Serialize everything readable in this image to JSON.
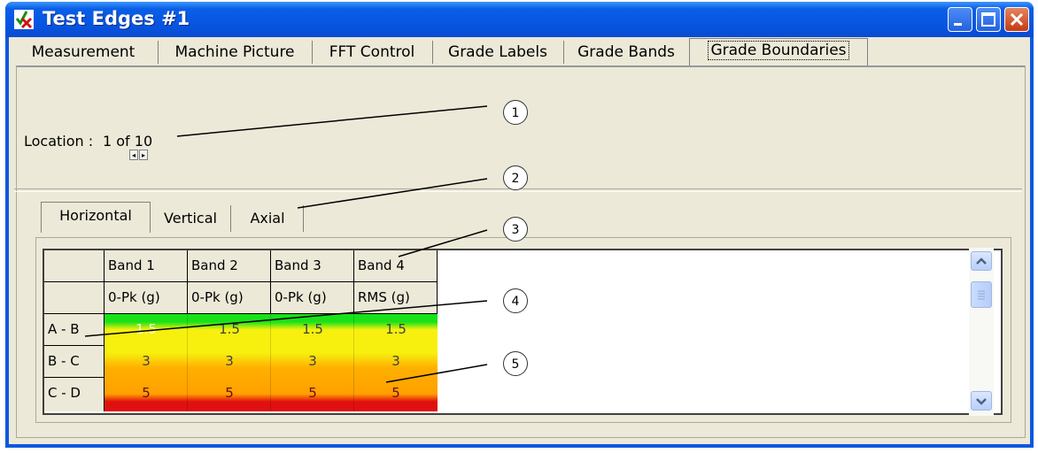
{
  "window": {
    "title": "Test Edges #1",
    "title_bar_color": "#0a58e0"
  },
  "tabs": [
    {
      "label": "Measurement",
      "active": false
    },
    {
      "label": "Machine Picture",
      "active": false
    },
    {
      "label": "FFT Control",
      "active": false
    },
    {
      "label": "Grade Labels",
      "active": false
    },
    {
      "label": "Grade Bands",
      "active": false
    },
    {
      "label": "Grade Boundaries",
      "active": true
    }
  ],
  "location": {
    "label": "Location :",
    "value": "1 of 10"
  },
  "subtabs": [
    {
      "label": "Horizontal",
      "active": true
    },
    {
      "label": "Vertical",
      "active": false
    },
    {
      "label": "Axial",
      "active": false
    }
  ],
  "grid": {
    "header_row1": [
      "Band 1",
      "Band 2",
      "Band 3",
      "Band 4"
    ],
    "header_row2": [
      "0-Pk (g)",
      "0-Pk (g)",
      "0-Pk (g)",
      "RMS (g)"
    ],
    "rows": [
      {
        "label": "A - B",
        "values": [
          "1.5",
          "1.5",
          "1.5",
          "1.5"
        ]
      },
      {
        "label": "B - C",
        "values": [
          "3",
          "3",
          "3",
          "3"
        ]
      },
      {
        "label": "C - D",
        "values": [
          "5",
          "5",
          "5",
          "5"
        ]
      }
    ],
    "colors": {
      "green": "#19e219",
      "yellow": "#f7f00e",
      "orange": "#ffa000",
      "red": "#e01010"
    }
  },
  "callouts": [
    "1",
    "2",
    "3",
    "4",
    "5"
  ],
  "icons": {
    "app": "check-x-icon",
    "minimize": "minimize-icon",
    "maximize": "maximize-icon",
    "close": "close-icon",
    "scroll_up": "chevron-up-icon",
    "scroll_down": "chevron-down-icon"
  }
}
